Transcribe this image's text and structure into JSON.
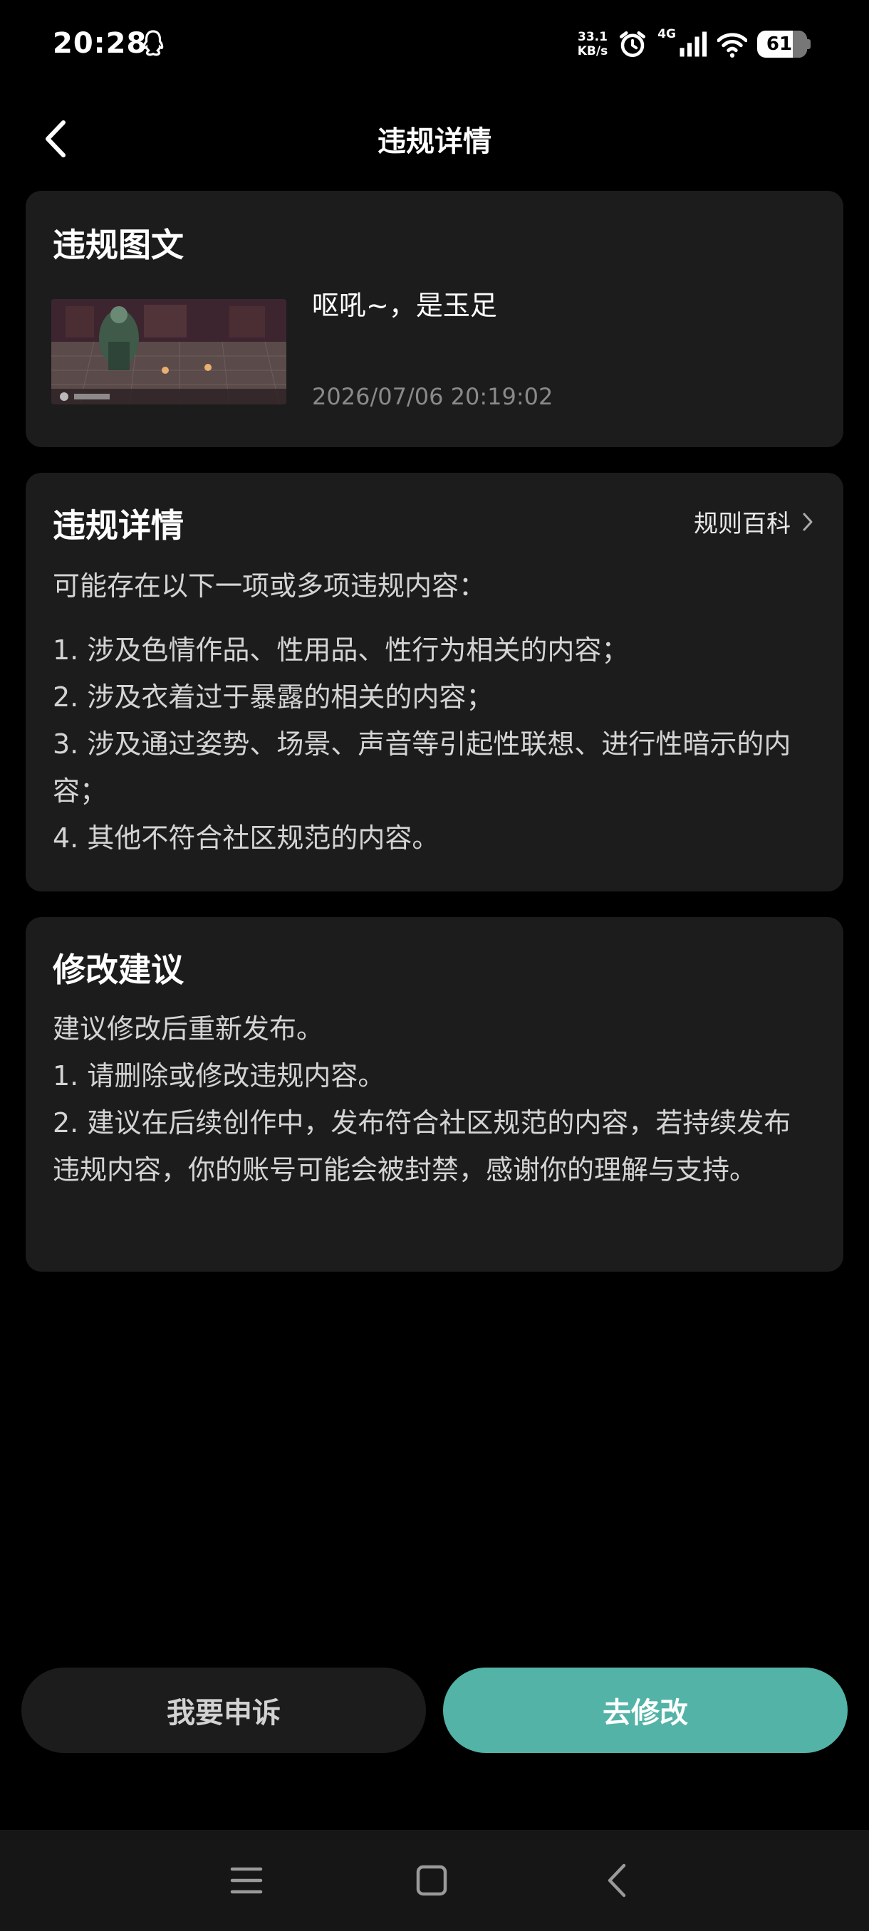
{
  "status_bar": {
    "time": "20:28",
    "network_speed_value": "33.1",
    "network_speed_unit": "KB/s",
    "network_type": "4G",
    "battery": "61",
    "icons": [
      "qq-icon",
      "alarm-icon",
      "signal-icon",
      "wifi-icon",
      "battery-icon"
    ]
  },
  "header": {
    "title": "违规详情",
    "back_icon": "chevron-left-icon"
  },
  "post_card": {
    "title": "违规图文",
    "post_text": "呕吼~，是玉足",
    "timestamp": "2026/07/06 20:19:02"
  },
  "violation_card": {
    "title": "违规详情",
    "rules_link": "规则百科",
    "intro": "可能存在以下一项或多项违规内容：",
    "items": [
      "1. 涉及色情作品、性用品、性行为相关的内容；",
      "2. 涉及衣着过于暴露的相关的内容；",
      "3. 涉及通过姿势、场景、声音等引起性联想、进行性暗示的内容；",
      "4. 其他不符合社区规范的内容。"
    ]
  },
  "suggestion_card": {
    "title": "修改建议",
    "lines": [
      "建议修改后重新发布。",
      "1. 请删除或修改违规内容。",
      "2. 建议在后续创作中，发布符合社区规范的内容，若持续发布违规内容，你的账号可能会被封禁，感谢你的理解与支持。"
    ]
  },
  "actions": {
    "appeal": "我要申诉",
    "edit": "去修改"
  },
  "colors": {
    "background": "#000000",
    "card": "#1c1c1c",
    "accent": "#52b3a6"
  }
}
